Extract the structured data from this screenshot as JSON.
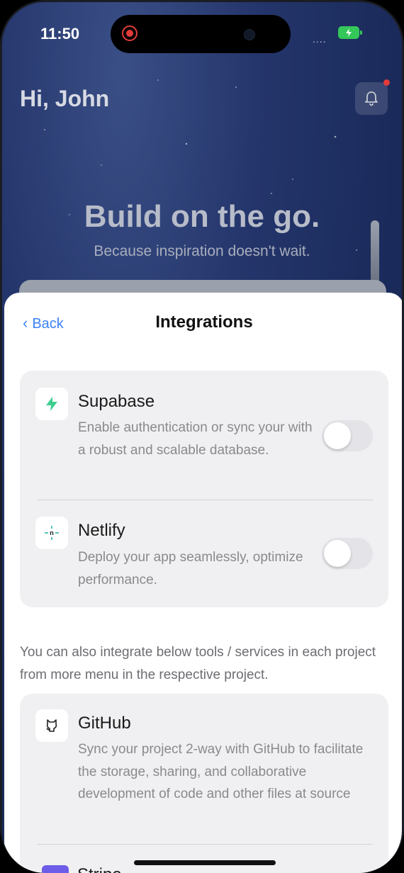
{
  "status_bar": {
    "time": "11:50",
    "signal": "...."
  },
  "header": {
    "greeting": "Hi, John"
  },
  "hero": {
    "title": "Build on the go.",
    "subtitle": "Because inspiration doesn't wait."
  },
  "sheet": {
    "back_label": "Back",
    "title": "Integrations",
    "connected": [
      {
        "name": "Supabase",
        "description": "Enable authentication or sync your with a robust and scalable database.",
        "icon": "bolt-icon",
        "enabled": false
      },
      {
        "name": "Netlify",
        "description": "Deploy your app seamlessly, optimize performance.",
        "icon": "netlify-icon",
        "enabled": false
      }
    ],
    "note": "You can also integrate below tools / services in each project from more menu in the respective project.",
    "project_tools": [
      {
        "name": "GitHub",
        "description": "Sync your project 2-way with GitHub to facilitate the storage, sharing, and collaborative development of code and other files at source",
        "icon": "github-icon"
      },
      {
        "name": "Stripe",
        "icon": "stripe-icon"
      }
    ]
  },
  "colors": {
    "accent": "#3b82f6",
    "supabase": "#3ecf8e",
    "netlify": "#32b3a6",
    "notification": "#e23b3b",
    "battery": "#34c759"
  }
}
